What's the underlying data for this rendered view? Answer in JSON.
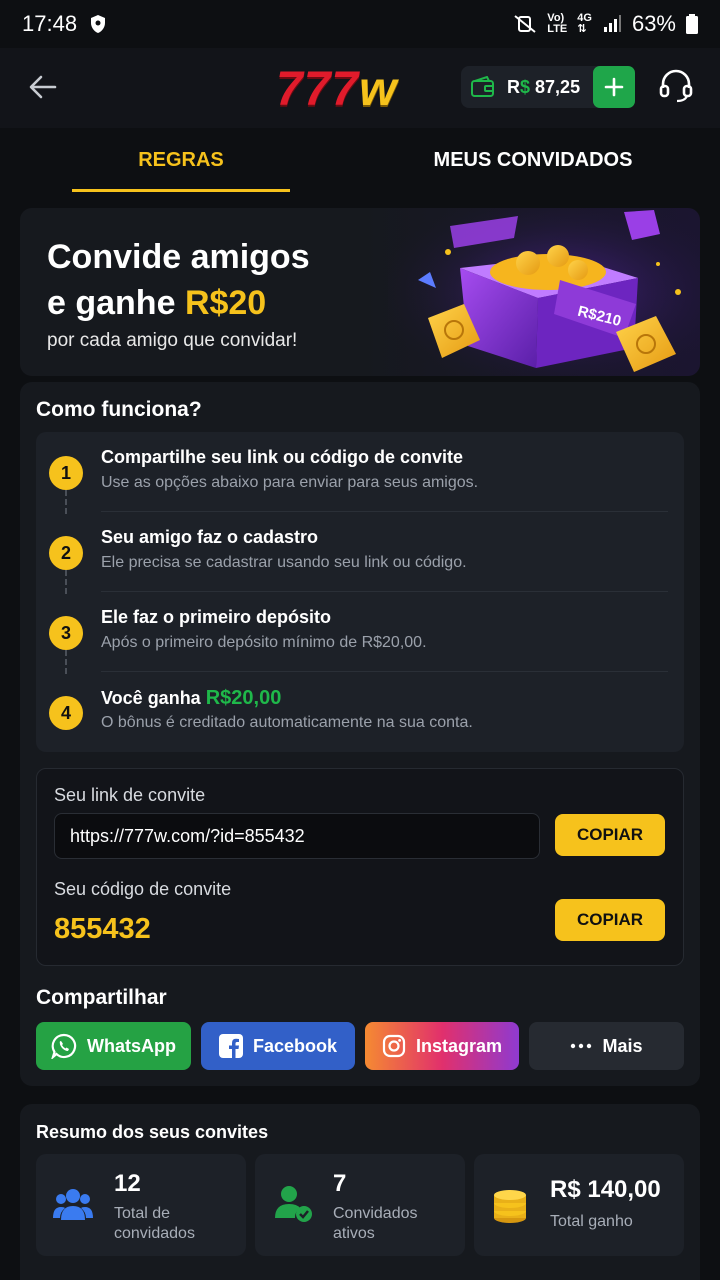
{
  "status_bar": {
    "time": "17:48",
    "battery": "63%"
  },
  "header": {
    "logo_digits": "777",
    "logo_letter": "w",
    "balance_currency": "R",
    "balance_symbol": "$",
    "balance_value": "87,25"
  },
  "tabs": [
    {
      "label": "REGRAS",
      "active": true
    },
    {
      "label": "MEUS CONVIDADOS",
      "active": false
    }
  ],
  "banner": {
    "line1": "Convide amigos",
    "line2_prefix": "e ganhe ",
    "line2_amount": "R$20",
    "subtitle": "por cada amigo que convidar!",
    "ticket_text": "R$210"
  },
  "how_it_works": {
    "title": "Como funciona?",
    "steps": [
      {
        "number": "1",
        "title": "Compartilhe seu link ou código de convite",
        "desc": "Use as opções abaixo para enviar para seus amigos."
      },
      {
        "number": "2",
        "title": "Seu amigo faz o cadastro",
        "desc": "Ele precisa se cadastrar usando seu link ou código."
      },
      {
        "number": "3",
        "title": "Ele faz o primeiro depósito",
        "desc": "Após o primeiro depósito mínimo de R$20,00."
      },
      {
        "number": "4",
        "title": "Você ganha ",
        "title_amount": "R$20,00",
        "desc": "O bônus é creditado automaticamente na sua conta."
      }
    ]
  },
  "invite": {
    "link_label": "Seu link de convite",
    "link_value": "https://777w.com/?id=855432",
    "code_label": "Seu código de convite",
    "code_value": "855432",
    "copy_label": "COPIAR"
  },
  "share": {
    "title": "Compartilhar",
    "buttons": [
      {
        "label": "WhatsApp",
        "color": "#25a244"
      },
      {
        "label": "Facebook",
        "color": "#3260c8"
      },
      {
        "label": "Instagram",
        "color": "#e1306c"
      },
      {
        "label": "Mais",
        "color": "#262a31"
      }
    ]
  },
  "summary": {
    "title": "Resumo dos seus convites",
    "stats": [
      {
        "value": "12",
        "label_line1": "Total de",
        "label_line2": "convidados"
      },
      {
        "value": "7",
        "label_line1": "Convidados",
        "label_line2": "ativos"
      },
      {
        "value": "R$ 140,00",
        "label_line1": "Total ganho",
        "label_line2": ""
      }
    ]
  },
  "colors": {
    "accent": "#f6c21c",
    "green": "#1fb84a",
    "background": "#0d0f12",
    "card": "#16191e"
  }
}
